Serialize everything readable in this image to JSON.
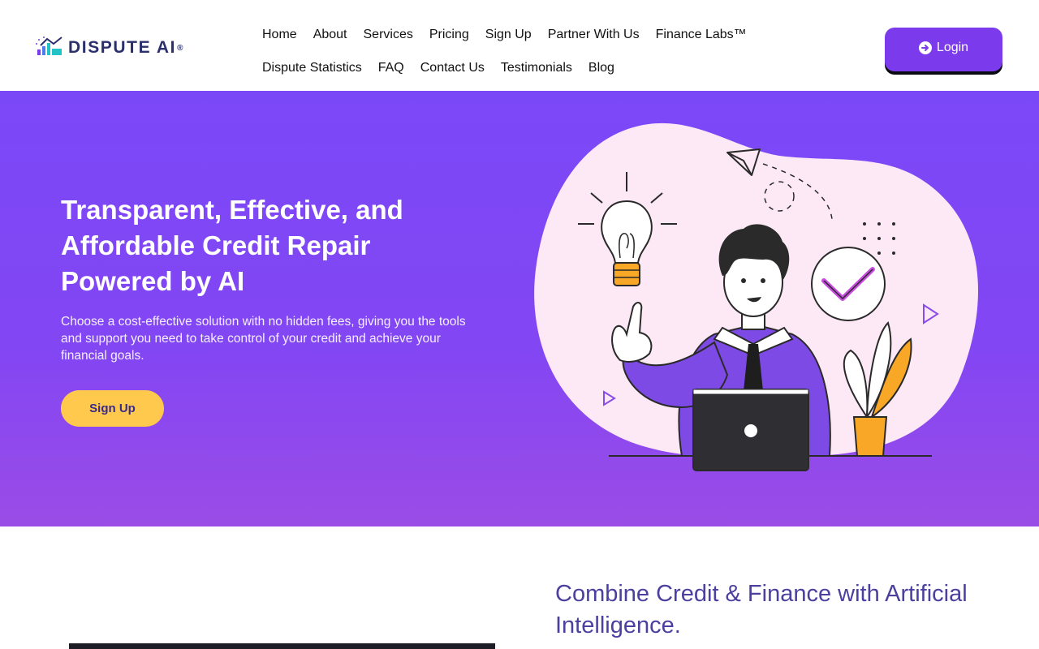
{
  "brand": {
    "name": "DISPUTE AI",
    "reg_mark": "®",
    "colors": {
      "primary": "#7c3aed",
      "accent": "#ffc94d",
      "heading_purple": "#4b3fa0",
      "logo_navy": "#2b2f6b"
    }
  },
  "nav": {
    "row1": [
      "Home",
      "About",
      "Services",
      "Pricing",
      "Sign Up",
      "Partner With Us",
      "Finance Labs™"
    ],
    "row2": [
      "Dispute Statistics",
      "FAQ",
      "Contact Us",
      "Testimonials",
      "Blog"
    ]
  },
  "header": {
    "login_label": "Login",
    "login_icon": "arrow-circle-right-icon"
  },
  "hero": {
    "title": "Transparent, Effective, and Affordable Credit Repair Powered by AI",
    "subtitle": "Choose a cost-effective solution with no hidden fees, giving you the tools and support you need to take control of your credit and achieve your financial goals.",
    "cta_label": "Sign Up",
    "illustration": "person-with-laptop-lightbulb-checkmark-illustration"
  },
  "section2": {
    "title": "Combine Credit & Finance with Artificial Intelligence."
  }
}
